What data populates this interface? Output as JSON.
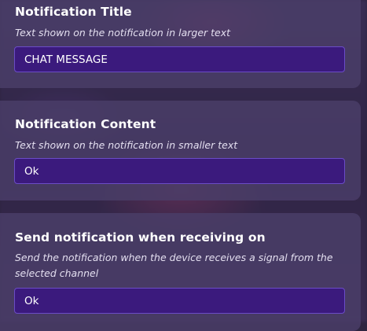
{
  "settings": [
    {
      "label": "Notification Title",
      "description": "Text shown on the notification in larger text",
      "value": "CHAT MESSAGE"
    },
    {
      "label": "Notification Content",
      "description": "Text shown on the notification in smaller text",
      "value": "Ok"
    },
    {
      "label": "Send notification when receiving on",
      "description": "Send the notification when the device receives a signal from the selected channel",
      "value": "Ok"
    }
  ],
  "colors": {
    "card_background": "#4a3e69",
    "field_background": "#3b1a7d",
    "field_border": "#6b4cc6",
    "text_primary": "#ffffff",
    "text_secondary": "#e4dff0"
  }
}
